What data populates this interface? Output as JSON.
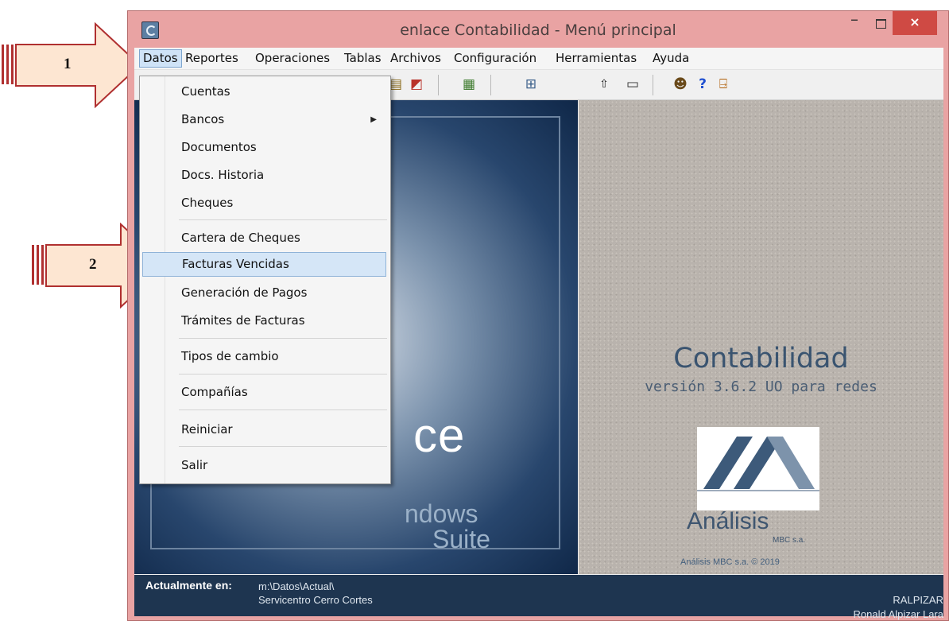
{
  "window": {
    "title": "enlace Contabilidad - Menú principal",
    "close_glyph": "×"
  },
  "menubar": {
    "items": [
      "Datos",
      "Reportes",
      "Operaciones",
      "Tablas",
      "Archivos",
      "Configuración",
      "Herramientas",
      "Ayuda"
    ],
    "active": "Datos"
  },
  "dropdown": {
    "items": [
      {
        "label": "Cuentas"
      },
      {
        "label": "Bancos",
        "submenu": true
      },
      {
        "label": "Documentos"
      },
      {
        "label": "Docs. Historia"
      },
      {
        "label": "Cheques"
      },
      {
        "label": "Cartera de Cheques"
      },
      {
        "label": "Facturas Vencidas",
        "highlighted": true
      },
      {
        "label": "Generación de Pagos"
      },
      {
        "label": "Trámites de Facturas"
      },
      {
        "label": "Tipos de cambio"
      },
      {
        "label": "Compañías"
      },
      {
        "label": "Reiniciar"
      },
      {
        "label": "Salir"
      }
    ]
  },
  "toolbar": {
    "icons": [
      "report-icon",
      "chart-icon",
      "ledger-icon",
      "network-icon",
      "up-arrow-icon",
      "window-icon",
      "user-icon",
      "help-icon",
      "exit-icon"
    ]
  },
  "splash": {
    "word": "ce",
    "sub1": "ndows",
    "sub2": "Suite",
    "app_name": "Contabilidad",
    "version": "versión 3.6.2 UO para redes",
    "logo_word": "Análisis",
    "logo_sub": "MBC s.a.",
    "copyright": "Análisis MBC s.a. © 2019"
  },
  "status": {
    "label": "Actualmente en:",
    "path": "m:\\Datos\\Actual\\",
    "company": "Servicentro Cerro Cortes",
    "user": "RALPIZAR",
    "user_name": "Ronald Alpizar Lara"
  },
  "callouts": [
    {
      "number": "1"
    },
    {
      "number": "2"
    }
  ],
  "colors": {
    "titlebar": "#e9a3a3",
    "close_button": "#cf4a44",
    "menu_highlight": "#d5e6f7",
    "callout_fill": "#fde6d2",
    "callout_stroke": "#b03030",
    "statusbar": "#1e3550"
  }
}
